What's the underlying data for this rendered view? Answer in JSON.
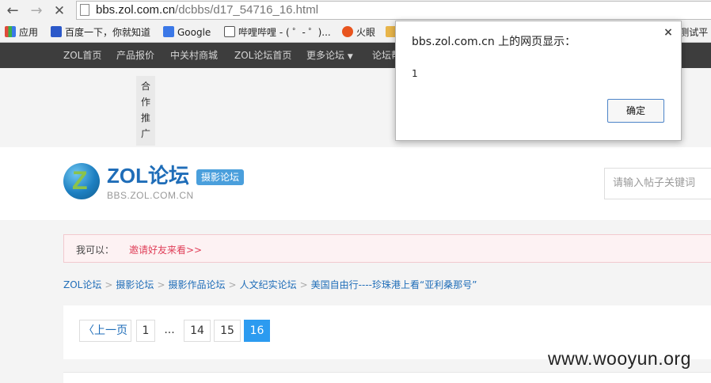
{
  "browser": {
    "url_host": "bbs.zol.com.cn",
    "url_path": "/dcbbs/d17_54716_16.html",
    "bookmarks": [
      {
        "label": "应用",
        "color": "#e04a3a"
      },
      {
        "label": "百度一下，你就知道",
        "color": "#2b58c9"
      },
      {
        "label": "Google",
        "color": "#3b78e7"
      },
      {
        "label": "哔哩哔哩 - ( ゜- ゜)...",
        "color": "#555555"
      },
      {
        "label": "火眼",
        "color": "#e8541e"
      },
      {
        "label": "",
        "color": "#e8b54a"
      },
      {
        "label": "s测试平",
        "color": "#555555"
      }
    ]
  },
  "topnav": {
    "items": [
      "ZOL首页",
      "产品报价",
      "中关村商城",
      "ZOL论坛首页",
      "更多论坛",
      "论坛帮"
    ]
  },
  "ad": {
    "chars": [
      "合",
      "作",
      "推",
      "广"
    ]
  },
  "header": {
    "logo_mark": "Z",
    "logo_title": "ZOL论坛",
    "logo_badge": "摄影论坛",
    "logo_domain": "BBS.ZOL.COM.CN",
    "search_placeholder": "请输入帖子关键词"
  },
  "notice": {
    "label": "我可以：",
    "link": "邀请好友来看>>"
  },
  "breadcrumb": {
    "items": [
      "ZOL论坛",
      "摄影论坛",
      "摄影作品论坛",
      "人文纪实论坛"
    ],
    "current": "美国自由行----珍珠港上看“亚利桑那号”"
  },
  "pager": {
    "prev": "上一页",
    "pages": [
      "1",
      "...",
      "14",
      "15",
      "16"
    ],
    "active_page": "16"
  },
  "dialog": {
    "title": "bbs.zol.com.cn 上的网页显示：",
    "message": "1",
    "ok": "确定",
    "close": "×"
  },
  "watermark": "www.wooyun.org",
  "colors": {
    "accent": "#2c9bf0",
    "link": "#1f6db8",
    "nav_bg": "#3d3d3d"
  }
}
